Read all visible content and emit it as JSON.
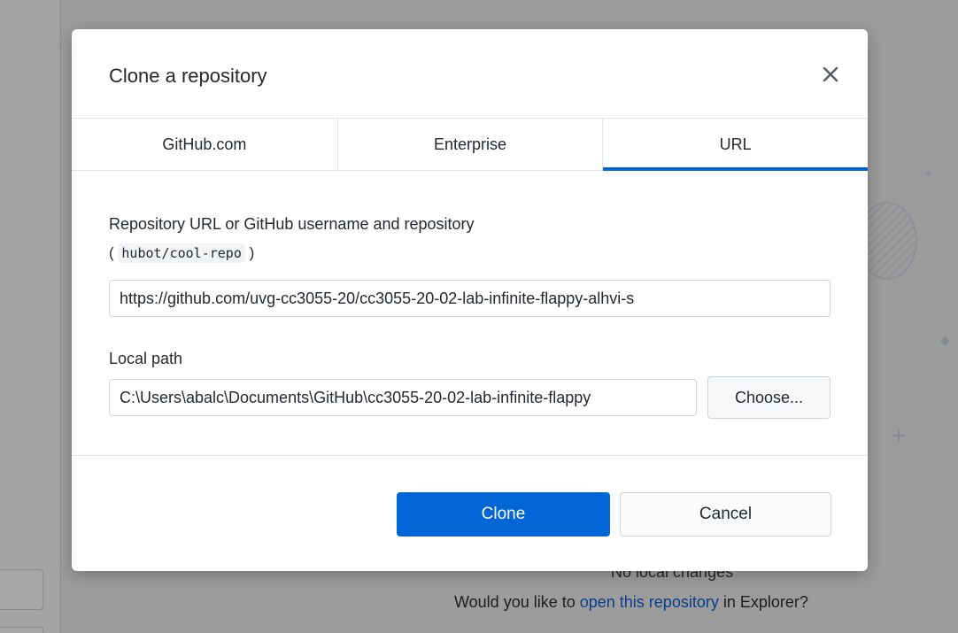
{
  "dialog": {
    "title": "Clone a repository",
    "close_icon": "close-icon"
  },
  "tabs": [
    {
      "label": "GitHub.com",
      "selected": false
    },
    {
      "label": "Enterprise",
      "selected": false
    },
    {
      "label": "URL",
      "selected": true
    }
  ],
  "url_field": {
    "label": "Repository URL or GitHub username and repository",
    "hint_open": "(",
    "hint_code": "hubot/cool-repo",
    "hint_close": ")",
    "value": "https://github.com/uvg-cc3055-20/cc3055-20-02-lab-infinite-flappy-alhvi-s"
  },
  "local_path": {
    "label": "Local path",
    "value": "C:\\Users\\abalc\\Documents\\GitHub\\cc3055-20-02-lab-infinite-flappy",
    "choose_label": "Choose..."
  },
  "footer": {
    "clone_label": "Clone",
    "cancel_label": "Cancel"
  },
  "background": {
    "no_changes": "No local changes",
    "question_prefix": "Would you like to ",
    "question_link": "open this repository",
    "question_suffix": " in Explorer?"
  },
  "colors": {
    "accent": "#0366d6",
    "overlay": "#9c9c9c"
  }
}
